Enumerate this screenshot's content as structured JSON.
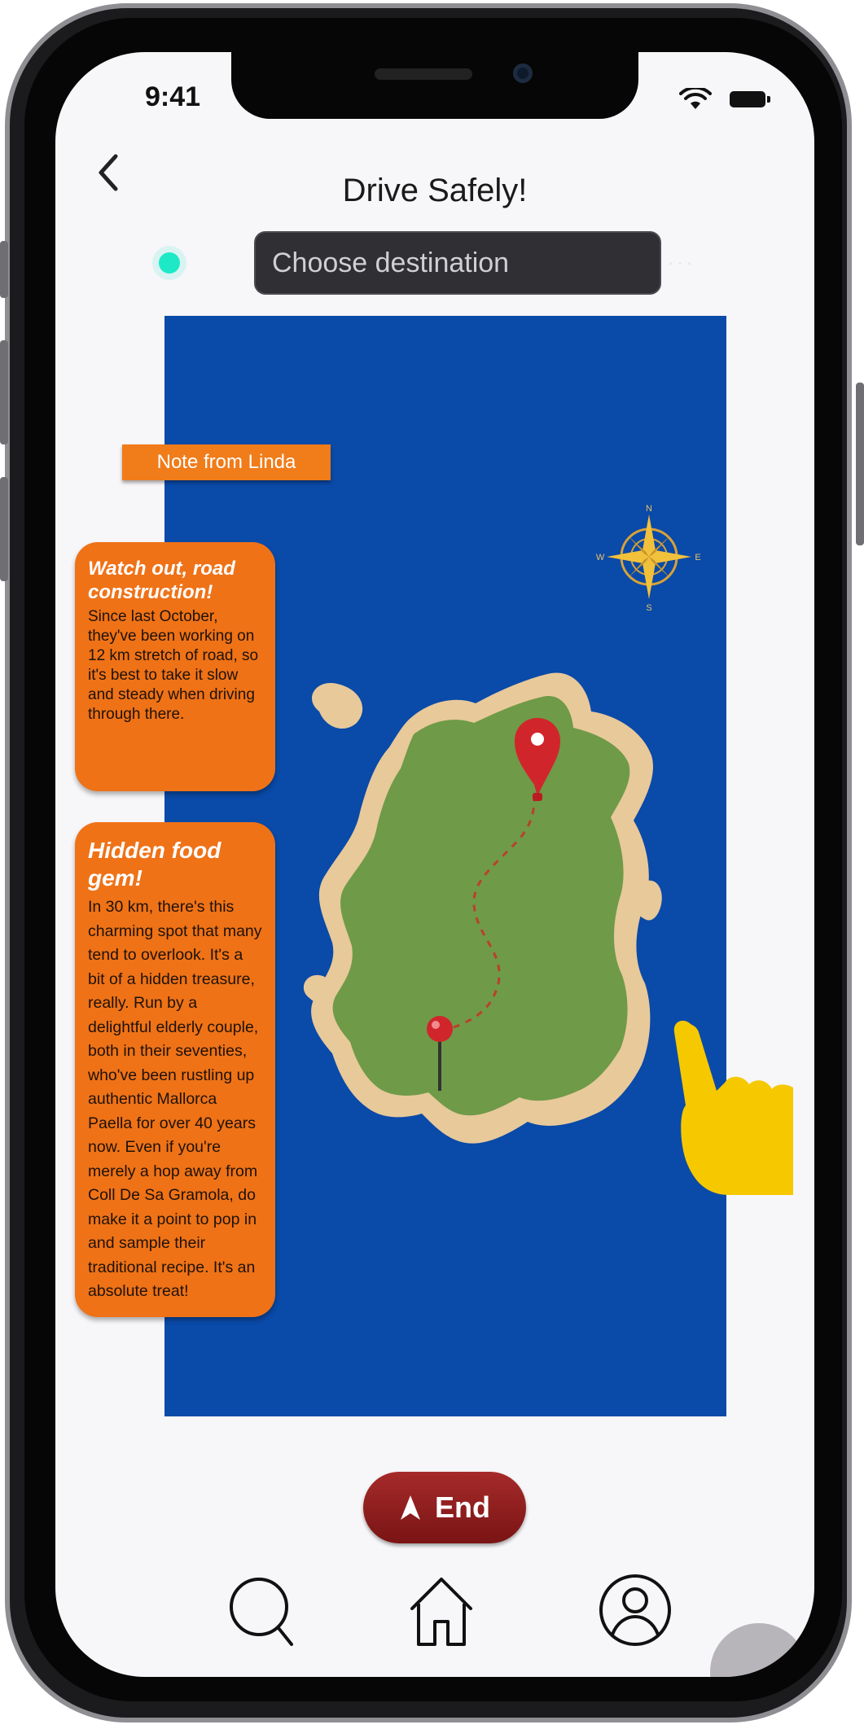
{
  "status_bar": {
    "time": "9:41"
  },
  "header": {
    "title": "Drive Safely!"
  },
  "destination": {
    "placeholder": "Choose destination"
  },
  "map": {
    "note_header": "Note from Linda",
    "compass": {
      "n": "N",
      "e": "E",
      "s": "S",
      "w": "W"
    },
    "cards": [
      {
        "title": "Watch out, road construction!",
        "body": "Since last October, they've been working on 12 km stretch of road, so it's best to take it slow and steady when driving through there."
      },
      {
        "title": "Hidden food gem!",
        "body": "In 30 km, there's this charming spot that many tend to overlook. It's a bit of a hidden treasure, really. Run by a delightful elderly couple, both in their seventies, who've been rustling up authentic Mallorca Paella for over 40 years now. Even if you're merely a hop away from Coll De Sa Gramola, do make it a point to pop in and sample their traditional recipe. It's an absolute treat!"
      }
    ],
    "colors": {
      "sea": "#0a4aa8",
      "land": "#6f9a48",
      "sand": "#e8c99a",
      "pin": "#d0262b",
      "card": "#ef7217",
      "hand": "#f6c800"
    }
  },
  "end_button": {
    "label": "End"
  },
  "tab_bar": {
    "icons": [
      "search-icon",
      "home-icon",
      "profile-icon"
    ]
  }
}
